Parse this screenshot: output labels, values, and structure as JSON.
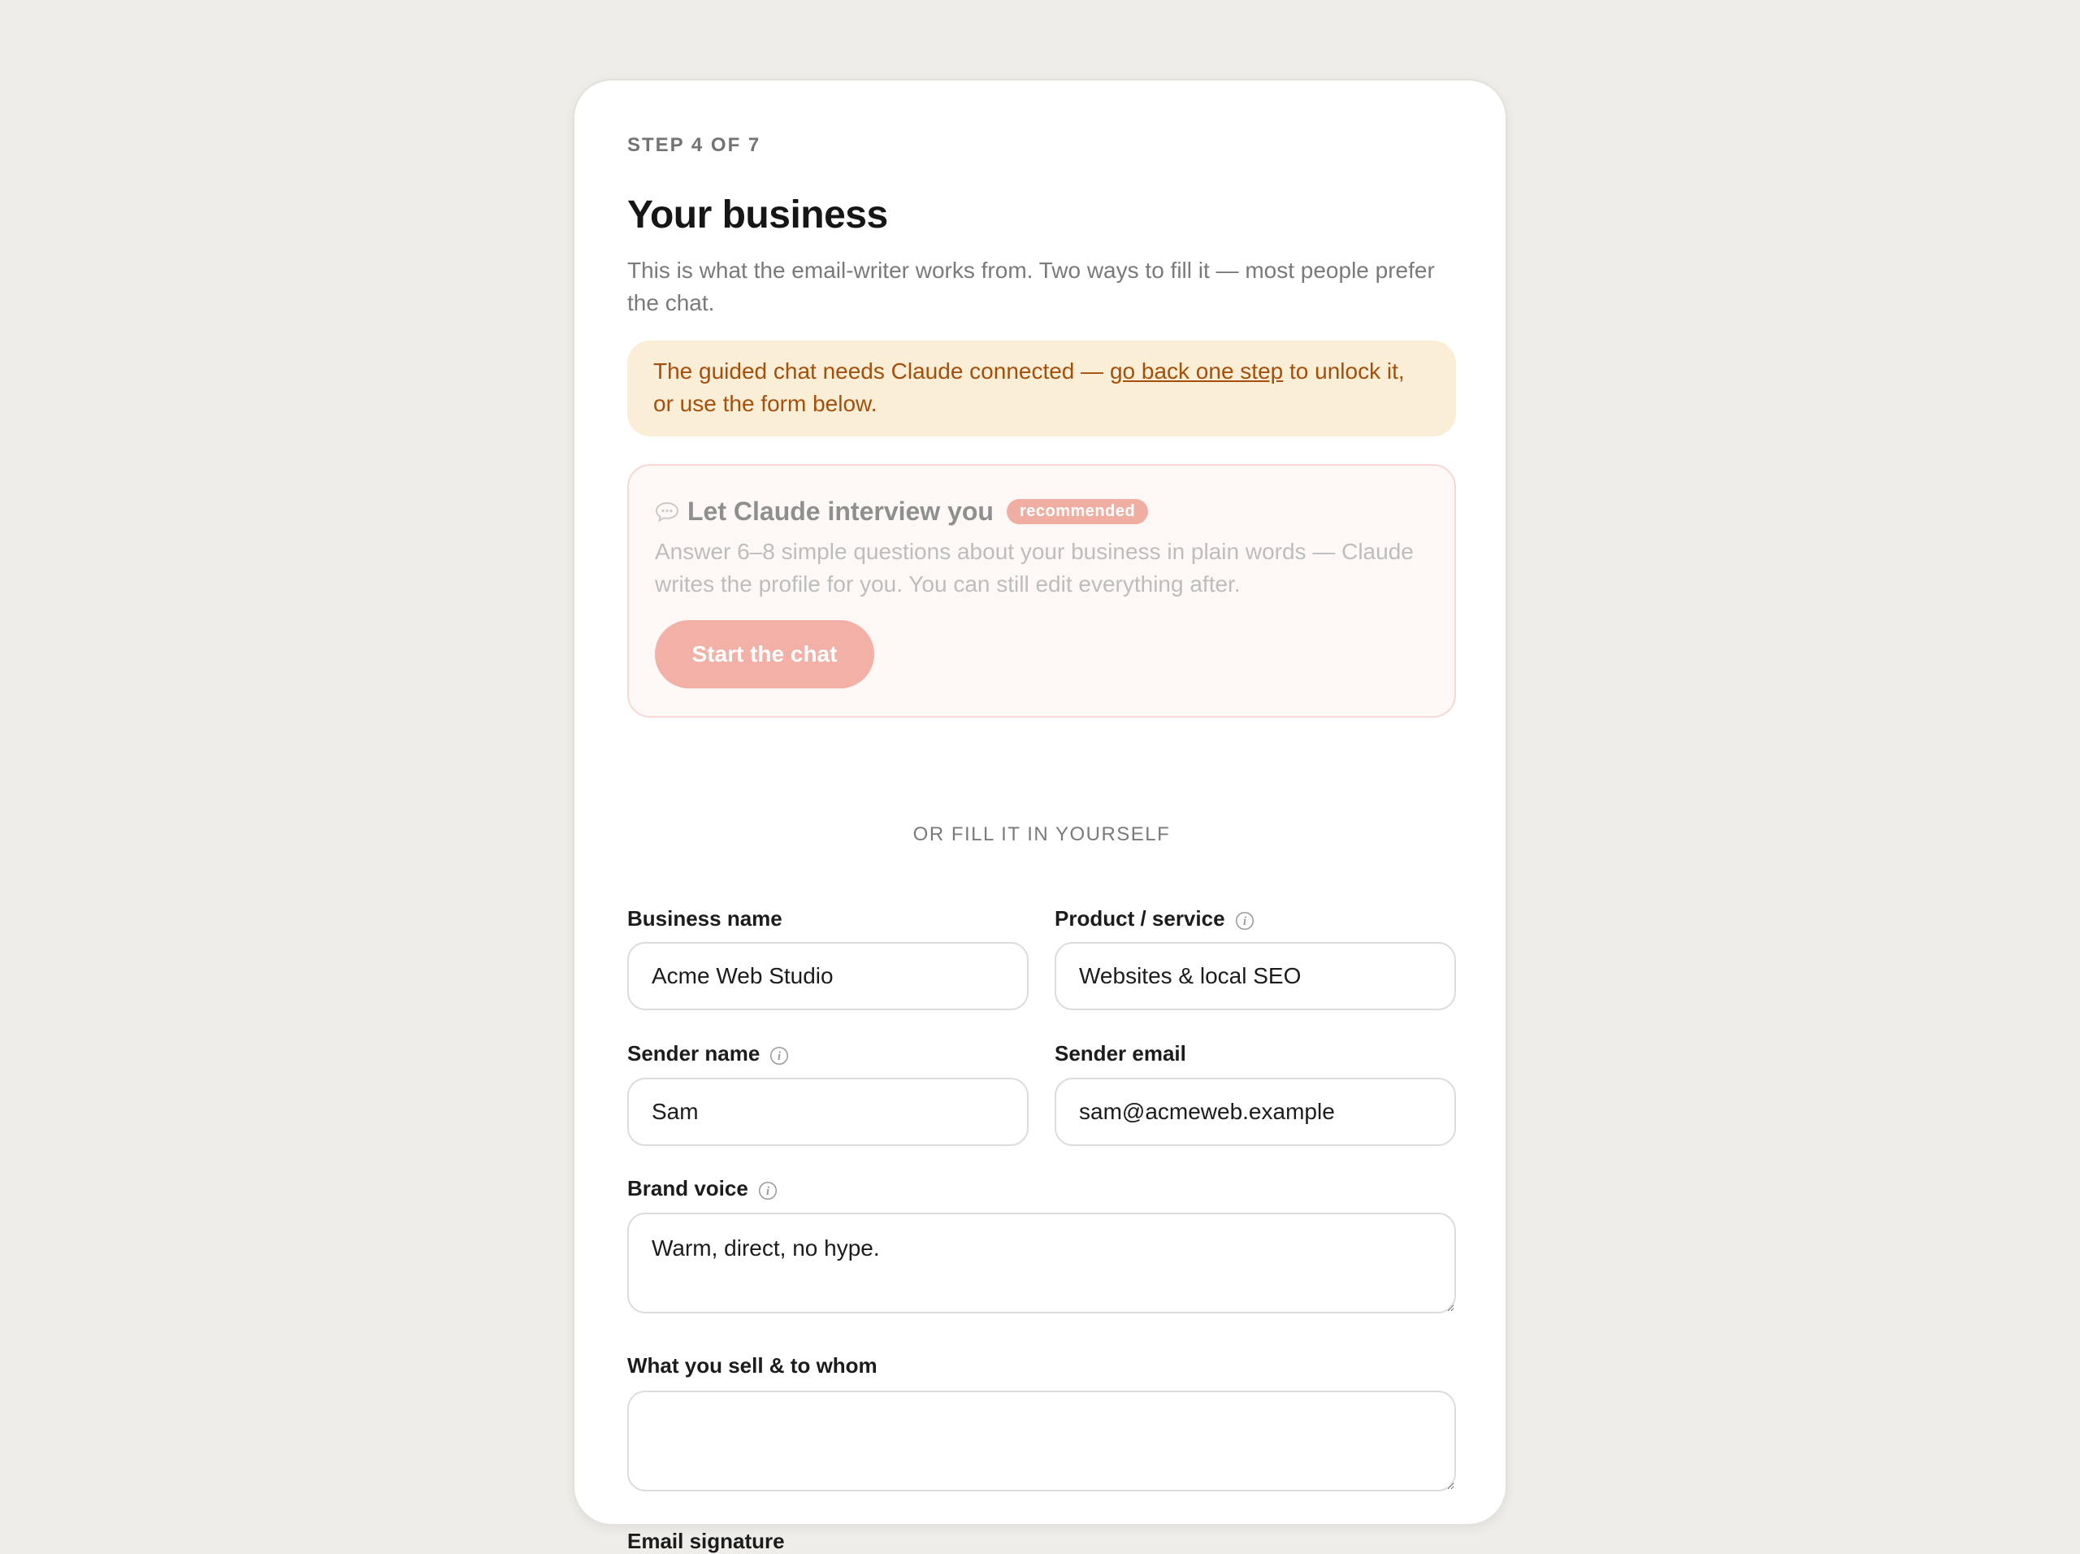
{
  "header": {
    "step": "STEP 4 OF 7",
    "title": "Your business",
    "subtitle": "This is what the email-writer works from. Two ways to fill it — most people prefer the chat."
  },
  "warning": {
    "prefix": "The guided chat needs Claude connected — ",
    "link": "go back one step",
    "suffix": " to unlock it, or use the form below."
  },
  "chat_card": {
    "icon": "speech-bubble-icon",
    "title": "Let Claude interview you",
    "badge": "recommended",
    "description": "Answer 6–8 simple questions about your business in plain words — Claude writes the profile for you. You can still edit everything after.",
    "button": "Start the chat"
  },
  "divider": "OR FILL IT IN YOURSELF",
  "form": {
    "business_name": {
      "label": "Business name",
      "value": "Acme Web Studio"
    },
    "product_service": {
      "label": "Product / service",
      "value": "Websites & local SEO"
    },
    "sender_name": {
      "label": "Sender name",
      "value": "Sam"
    },
    "sender_email": {
      "label": "Sender email",
      "value": "sam@acmeweb.example"
    },
    "brand_voice": {
      "label": "Brand voice",
      "value": "Warm, direct, no hype."
    },
    "what_you_sell": {
      "label": "What you sell & to whom",
      "value": ""
    },
    "email_signature": {
      "label": "Email signature"
    }
  },
  "colors": {
    "background": "#eeede9",
    "warning_bg": "#fbeed7",
    "warning_text": "#a64f0a",
    "accent": "#f2b0a6",
    "badge": "#f0aea2"
  }
}
